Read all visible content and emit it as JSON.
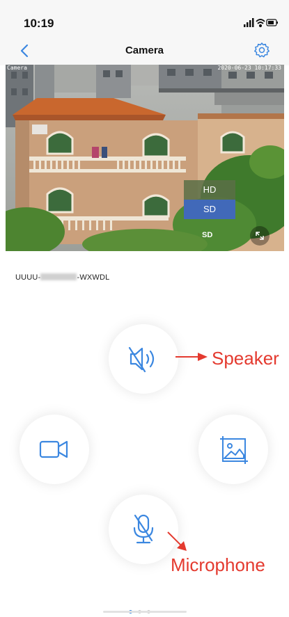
{
  "status_bar": {
    "time": "10:19"
  },
  "navbar": {
    "title": "Camera",
    "back_icon": "chevron-left-icon",
    "settings_icon": "gear-icon"
  },
  "video": {
    "osd_left": "Camera",
    "osd_right": "2020-06-23 10:17:33",
    "quality_options": [
      "HD",
      "SD"
    ],
    "current_quality": "SD",
    "fullscreen_icon": "expand-icon"
  },
  "device": {
    "name_prefix": "UUUU-",
    "name_suffix": "-WXWDL"
  },
  "controls": {
    "speaker_icon": "speaker-mute-icon",
    "record_icon": "video-camera-icon",
    "snapshot_icon": "image-icon",
    "microphone_icon": "microphone-mute-icon"
  },
  "annotations": {
    "speaker": "Speaker",
    "microphone": "Microphone"
  },
  "colors": {
    "accent": "#3b87e0",
    "annotation": "#e43a2f",
    "sd_highlight": "#4169b9"
  },
  "pagination": {
    "total": 3,
    "active": 1
  }
}
